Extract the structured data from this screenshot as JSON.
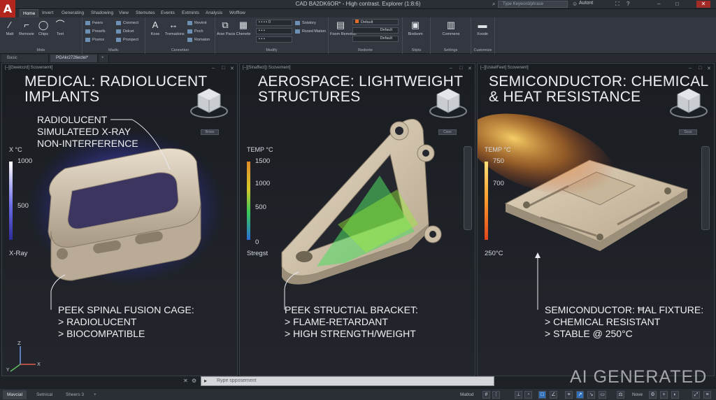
{
  "app": {
    "logo": "A",
    "window_title": "CAD BA2DK6OR* - High contrast. Explorer (1:8:6)",
    "search_placeholder": "Type Keyword/phrase",
    "account": "Autont"
  },
  "menu_tabs": [
    "Home",
    "Invert",
    "Generating",
    "Shadowing",
    "View",
    "Stemutes",
    "Events",
    "Extmints",
    "Analysis",
    "Wofflow"
  ],
  "ribbon": {
    "groups": [
      "Mole",
      "Madic",
      "Cennetion",
      "Modify",
      "Redonte",
      "Stipts",
      "Settings",
      "Customize"
    ],
    "buttons": [
      "Matt",
      "Removie",
      "Chips",
      "Text",
      "Kose",
      "Tremadons",
      "Arse Pacis",
      "Chenete",
      "Foom Remotter",
      "Bixdsom",
      "Commens",
      "Xoode"
    ],
    "small": [
      "Fwers",
      "Presefs",
      "Posrox",
      "Conmect",
      "Delcet",
      "Pronpect",
      "Revirot",
      "Poch",
      "Romaton",
      "Soistory",
      "Rsoed Mation"
    ],
    "dropdowns": [
      "Default",
      "Default",
      "Default"
    ]
  },
  "doc_tabs": [
    "Basic",
    "PGAkr2726ectel*"
  ],
  "viewports": [
    {
      "header": "[–][Gwelccrd] Scovenemt]",
      "title": "MEDICAL: RADIOLUCENT\nIMPLANTS",
      "legend": {
        "title": "X °C",
        "ticks": [
          "1000",
          "500"
        ],
        "bottom_label": "X-Ray",
        "colors": [
          "#ffffff",
          "#6e6ee8",
          "#2c2c9a"
        ]
      },
      "callout_top": "RADIOLUCENT\nSIMULATEED X-RAY\nNON-INTERFERENCE",
      "callout_bottom": "PEEK SPINAL FUSION CAGE:\n> RADIOLUCENT\n> BIOCOMPATIBLE",
      "nav_label": "Brxes"
    },
    {
      "header": "[–][Sinaffect]) Scovement]",
      "title": "AEROSPACE: LIGHTWEIGHT\nSTRUCTURES",
      "legend": {
        "title": "TEMP °C",
        "ticks": [
          "1500",
          "1000",
          "500",
          "0"
        ],
        "bottom_label": "Stregst",
        "colors": [
          "#e08a2a",
          "#d6c82a",
          "#38c95a",
          "#2a6fd6"
        ]
      },
      "callout_bottom": "PEEK STRUCTIAL BRACKET:\n> FLAME-RETARDANT\n> HIGH STRENGTH/WEIGHT",
      "nav_label": "Caxe"
    },
    {
      "header": "[–][UskelFeet] Scovenent]",
      "title": "SEMICONDUCTOR: CHEMICAL\n& HEAT RESISTANCE",
      "legend": {
        "title": "TEMP °C",
        "ticks": [
          "750",
          "700"
        ],
        "bottom_label": "250°C",
        "colors": [
          "#ffe27a",
          "#ff9a2a",
          "#e0451e"
        ]
      },
      "callout_bottom": "SEMICONDUCTOR: ĦАL FIXTURE:\n> CHEMICAL RESISTANT\n> STABLE @ 250°C",
      "nav_label": "Scux"
    }
  ],
  "command_line": {
    "placeholder": "Rype spposement"
  },
  "layout_tabs": [
    "Mavcial",
    "Setnical",
    "Sheers 3"
  ],
  "status": {
    "model": "Matlod",
    "annot": "Nove"
  },
  "watermark": "AI GENERATED",
  "accent": "#2e6fb7"
}
